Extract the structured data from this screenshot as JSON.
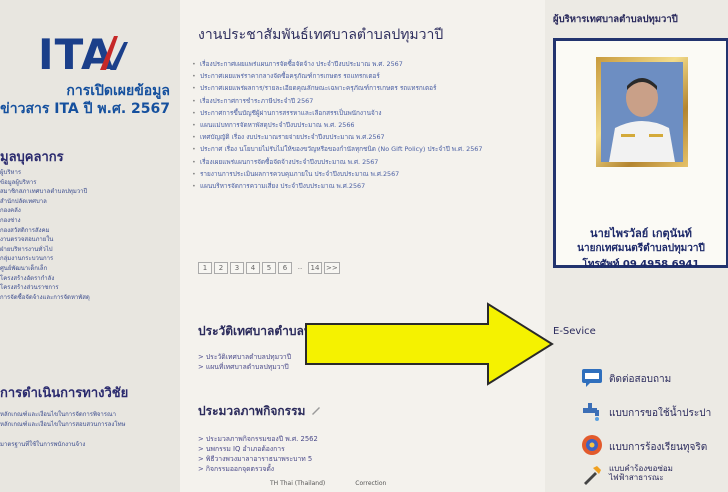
{
  "left_sidebar": {
    "ita_title": "การเปิดเผยข้อมูล",
    "ita_subtitle": "ข่าวสาร ITA ปี พ.ศ. 2567",
    "ita_logo_text": "ITA",
    "personnel_heading": "มูลบุคลากร",
    "personnel_items": [
      "ผู้บริหาร",
      "ข้อมูลผู้บริหาร",
      "สมาชิกสภาเทศบาลตำบลปทุมวาปี",
      "สำนักปลัดเทศบาล",
      "กองคลัง",
      "กองช่าง",
      "กองสวัสดิการสังคม",
      "งานตรวจสอบภายใน",
      "ฝ่ายบริหารงานทั่วไป",
      "กลุ่มงานกระบวนการ",
      "ศูนย์พัฒนาเด็กเล็ก",
      "โครงสร้างอัตรากำลัง",
      "โครงสร้างส่วนราชการ",
      "การจัดซื้อจัดจ้างและการจัดหาพัสดุ"
    ],
    "operations_heading": "การดำเนินการทางวิชัย",
    "operations_items": [
      "หลักเกณฑ์และเงื่อนไขในการจัดการพิจารณา",
      "หลักเกณฑ์และเงื่อนไขในการสอบสวนการลงโทษ",
      "",
      "มาตรฐานที่ใช้ในการพนักงานจ้าง"
    ]
  },
  "main": {
    "news_title": "งานประชาสัมพันธ์เทศบาลตำบลปทุมวาปี",
    "news_items": [
      "เรื่องประกาศเผยแพร่แผนการจัดซื้อจัดจ้าง ประจำปีงบประมาณ พ.ศ. 2567",
      "ประกาศเผยแพร่ราคากลางจัดซื้อครุภัณฑ์การเกษตร รถแทรกเตอร์",
      "ประกาศเผยแพร่ผลการ/รายละเอียดคุณลักษณะเฉพาะครุภัณฑ์การเกษตร รถแทรกเตอร์",
      "เรื่องประกาศการชำระภาษีประจำปี 2567",
      "ประกาศการขึ้นบัญชีผู้ผ่านการสรรหาและเลือกสรรเป็นพนักงานจ้าง",
      "แผนแม่บทการจัดหาพัสดุประจำปีงบประมาณ พ.ศ. 2566",
      "เทศบัญญัติ เรื่อง งบประมาณรายจ่ายประจำปีงบประมาณ พ.ศ.2567",
      "ประกาศ เรื่อง นโยบายไม่รับไม่ให้ของขวัญหรือของกำนัลทุกชนิด (No Gift Policy) ประจำปี พ.ศ. 2567",
      "เรื่องเผยแพร่แผนการจัดซื้อจัดจ้างประจำปีงบประมาณ พ.ศ. 2567",
      "รายงานการประเมินผลการควบคุมภายใน ประจำปีงบประมาณ พ.ศ.2567",
      "แผนบริหารจัดการความเสี่ยง ประจำปีงบประมาณ พ.ศ.2567"
    ],
    "pager": [
      "1",
      "2",
      "3",
      "4",
      "5",
      "6",
      "..",
      "14",
      ">>"
    ],
    "history_title": "ประวัติเทศบาลตำบลปทุมวาปี",
    "history_items": [
      "> ประวัติเทศบาลตำบลปทุมวาปี",
      "> แผนที่เทศบาลตำบลปทุมวาปี"
    ],
    "activities_title": "ประมวลภาพกิจกรรม",
    "activities_items": [
      "> ประมวลภาพกิจกรรมของปี พ.ศ. 2562",
      "> นพกรรม IQ อำเภอต้องการ",
      "> พิธีวางพวงมาลาอาราธนาพระบาท 5",
      "> กิจกรรมออกจุดตรวจตั้ง"
    ],
    "status_bar": [
      "TH Thai (Thailand)",
      "Correction"
    ]
  },
  "right_sidebar": {
    "exec_title": "ผู้บริหารเทศบาลตำบลปทุมวาปี",
    "exec_name": "นายไพรวัลย์ เกตุนันท์",
    "exec_position": "นายกเทศมนตรีตำบลปทุมวาปี",
    "exec_phone": "โทรศัพท์ 09 4958 6941",
    "eservice_title": "E-Sevice",
    "services": [
      {
        "label": "ติดต่อสอบถาม",
        "icon": "qa-chat-icon"
      },
      {
        "label": "แบบการขอใช้น้ำประปา",
        "icon": "water-tap-icon"
      },
      {
        "label": "แบบการร้องเรียนทุจริต",
        "icon": "complaint-globe-icon"
      },
      {
        "label": "แบบคำร้องขอซ่อมไฟฟ้าสาธารณะ",
        "icon": "repair-tools-icon"
      }
    ]
  },
  "colors": {
    "arrow_fill": "#f5f200",
    "arrow_outline": "#2a2a2a",
    "brand_blue": "#1b3f8a",
    "frame_navy": "#22336e"
  }
}
